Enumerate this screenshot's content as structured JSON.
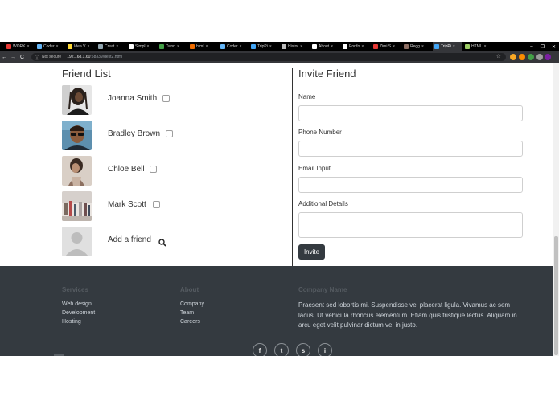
{
  "browser": {
    "tabs": [
      {
        "label": "WORK",
        "color": "#e53935"
      },
      {
        "label": "Coder",
        "color": "#64b5f6"
      },
      {
        "label": "Idea V",
        "color": "#fdd835"
      },
      {
        "label": "Creat",
        "color": "#90a4ae"
      },
      {
        "label": "Simpl",
        "color": "#ffffff"
      },
      {
        "label": "Dunn",
        "color": "#43a047"
      },
      {
        "label": "html",
        "color": "#ef6c00"
      },
      {
        "label": "Coder",
        "color": "#64b5f6"
      },
      {
        "label": "TripPi",
        "color": "#42a5f5"
      },
      {
        "label": "Histor",
        "color": "#bdbdbd"
      },
      {
        "label": "About",
        "color": "#ffffff"
      },
      {
        "label": "Portfo",
        "color": "#ffffff"
      },
      {
        "label": "Zimi S",
        "color": "#e53935"
      },
      {
        "label": "Regg",
        "color": "#8d6e63"
      },
      {
        "label": "TripPi",
        "color": "#42a5f5"
      },
      {
        "label": "HTML",
        "color": "#9ccc65"
      }
    ],
    "active_tab_index": 14,
    "new_tab": "+",
    "window_controls": [
      "–",
      "❐",
      "✕"
    ],
    "nav": {
      "back": "←",
      "forward": "→",
      "reload": "C"
    },
    "security": "Not secure",
    "url_host": "192.168.1.60",
    "url_path": ":58339/dest2.html",
    "star": "☆",
    "extension_colors": [
      "#f9a825",
      "#fb8c00",
      "#43a047",
      "#9e9e9e",
      "#7b1fa2"
    ]
  },
  "friends": {
    "title": "Friend List",
    "items": [
      {
        "name": "Joanna Smith"
      },
      {
        "name": "Bradley Brown"
      },
      {
        "name": "Chloe Bell"
      },
      {
        "name": "Mark Scott"
      }
    ],
    "add_label": "Add a friend"
  },
  "invite": {
    "title": "Invite Friend",
    "fields": [
      {
        "label": "Name",
        "value": ""
      },
      {
        "label": "Phone Number",
        "value": ""
      },
      {
        "label": "Email Input",
        "value": ""
      },
      {
        "label": "Additional Details",
        "value": ""
      }
    ],
    "button": "Invite"
  },
  "footer": {
    "services": {
      "heading": "Services",
      "links": [
        "Web design",
        "Development",
        "Hosting"
      ]
    },
    "about": {
      "heading": "About",
      "links": [
        "Company",
        "Team",
        "Careers"
      ]
    },
    "company": {
      "heading": "Company Name",
      "text": "Praesent sed lobortis mi. Suspendisse vel placerat ligula. Vivamus ac sem lacus. Ut vehicula rhoncus elementum. Etiam quis tristique lectus. Aliquam in arcu eget velit pulvinar dictum vel in justo."
    },
    "social": [
      "f",
      "t",
      "s",
      "i"
    ]
  },
  "colors": {
    "footer_bg": "#343a40",
    "button_bg": "#343a40",
    "text": "#333333"
  }
}
